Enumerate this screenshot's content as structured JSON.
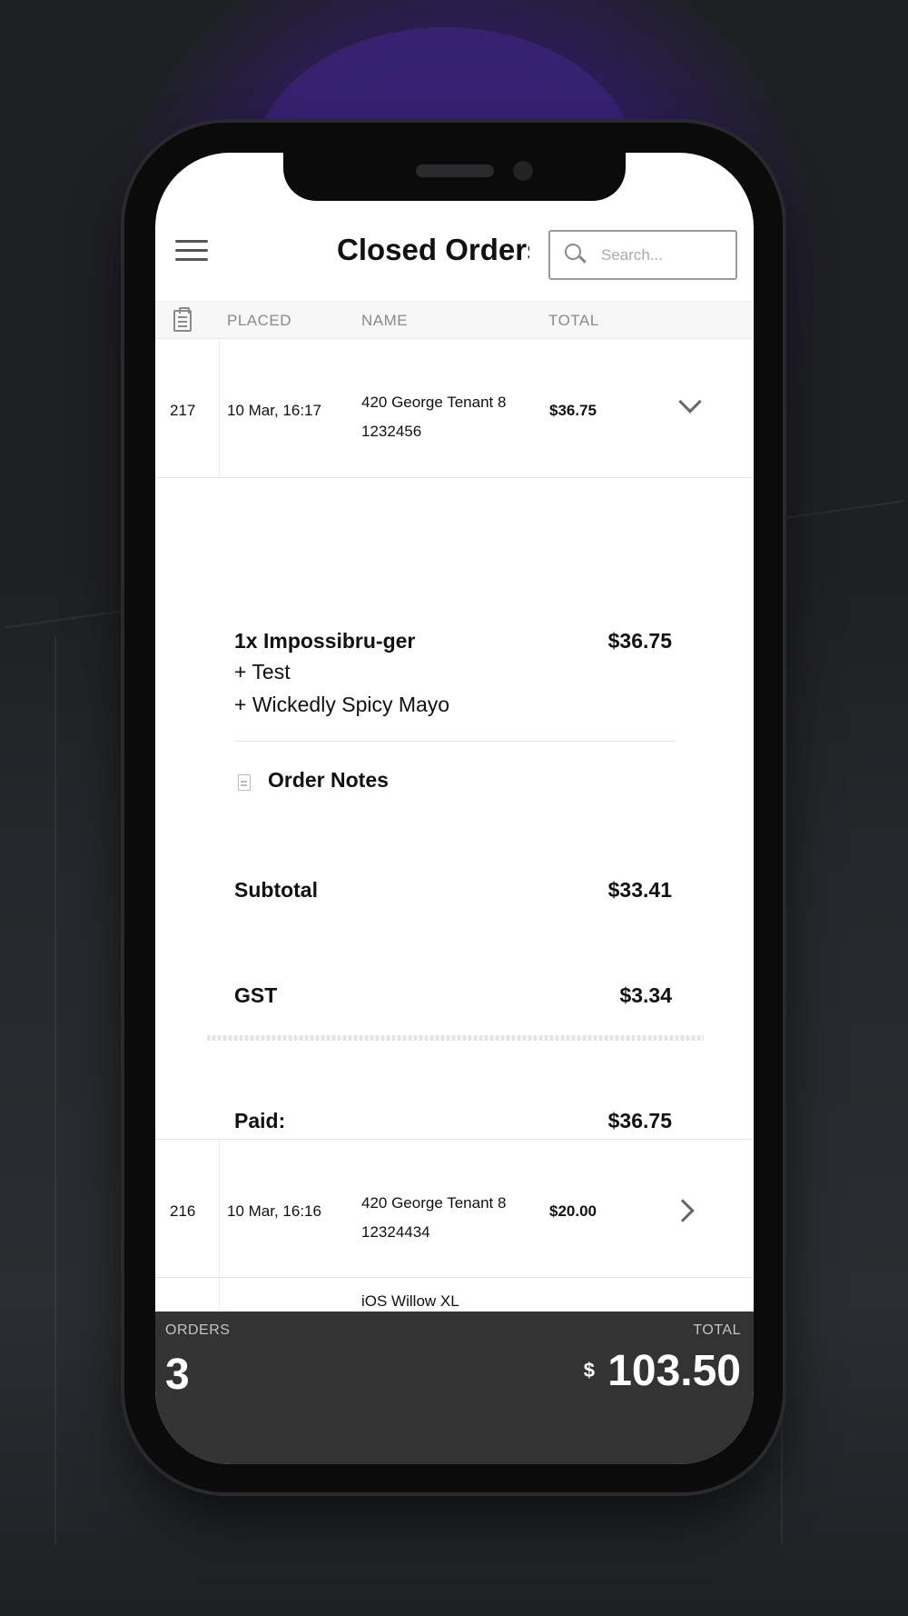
{
  "header": {
    "title": "Closed Orders",
    "search_placeholder": "Search..."
  },
  "table": {
    "columns": [
      "PLACED",
      "NAME",
      "TOTAL"
    ]
  },
  "orders": [
    {
      "id": "217",
      "placed": "10 Mar, 16:17",
      "name_line1": "420 George Tenant 8",
      "name_line2": "1232456",
      "total": "$36.75",
      "expanded": true
    },
    {
      "id": "216",
      "placed": "10 Mar, 16:16",
      "name_line1": "420 George Tenant 8",
      "name_line2": "12324434",
      "total": "$20.00",
      "expanded": false
    },
    {
      "id": "",
      "placed": "",
      "name_line1": "iOS Willow XL",
      "name_line2": "",
      "total": "",
      "expanded": false
    }
  ],
  "detail": {
    "item": "1x Impossibru-ger",
    "item_price": "$36.75",
    "modifiers": [
      "+ Test",
      "+ Wickedly Spicy Mayo"
    ],
    "notes_label": "Order Notes",
    "subtotal_label": "Subtotal",
    "subtotal_value": "$33.41",
    "gst_label": "GST",
    "gst_value": "$3.34",
    "paid_label": "Paid:",
    "paid_value": "$36.75"
  },
  "footer": {
    "orders_label": "ORDERS",
    "orders_count": "3",
    "total_label": "TOTAL",
    "currency": "$",
    "total_value": "103.50"
  },
  "icons": [
    "menu-icon",
    "search-icon",
    "clipboard-icon",
    "chevron-down-icon",
    "chevron-right-icon",
    "document-icon"
  ],
  "colors": {
    "footer_bg": "#333333",
    "background_accent": "#3a2276"
  }
}
